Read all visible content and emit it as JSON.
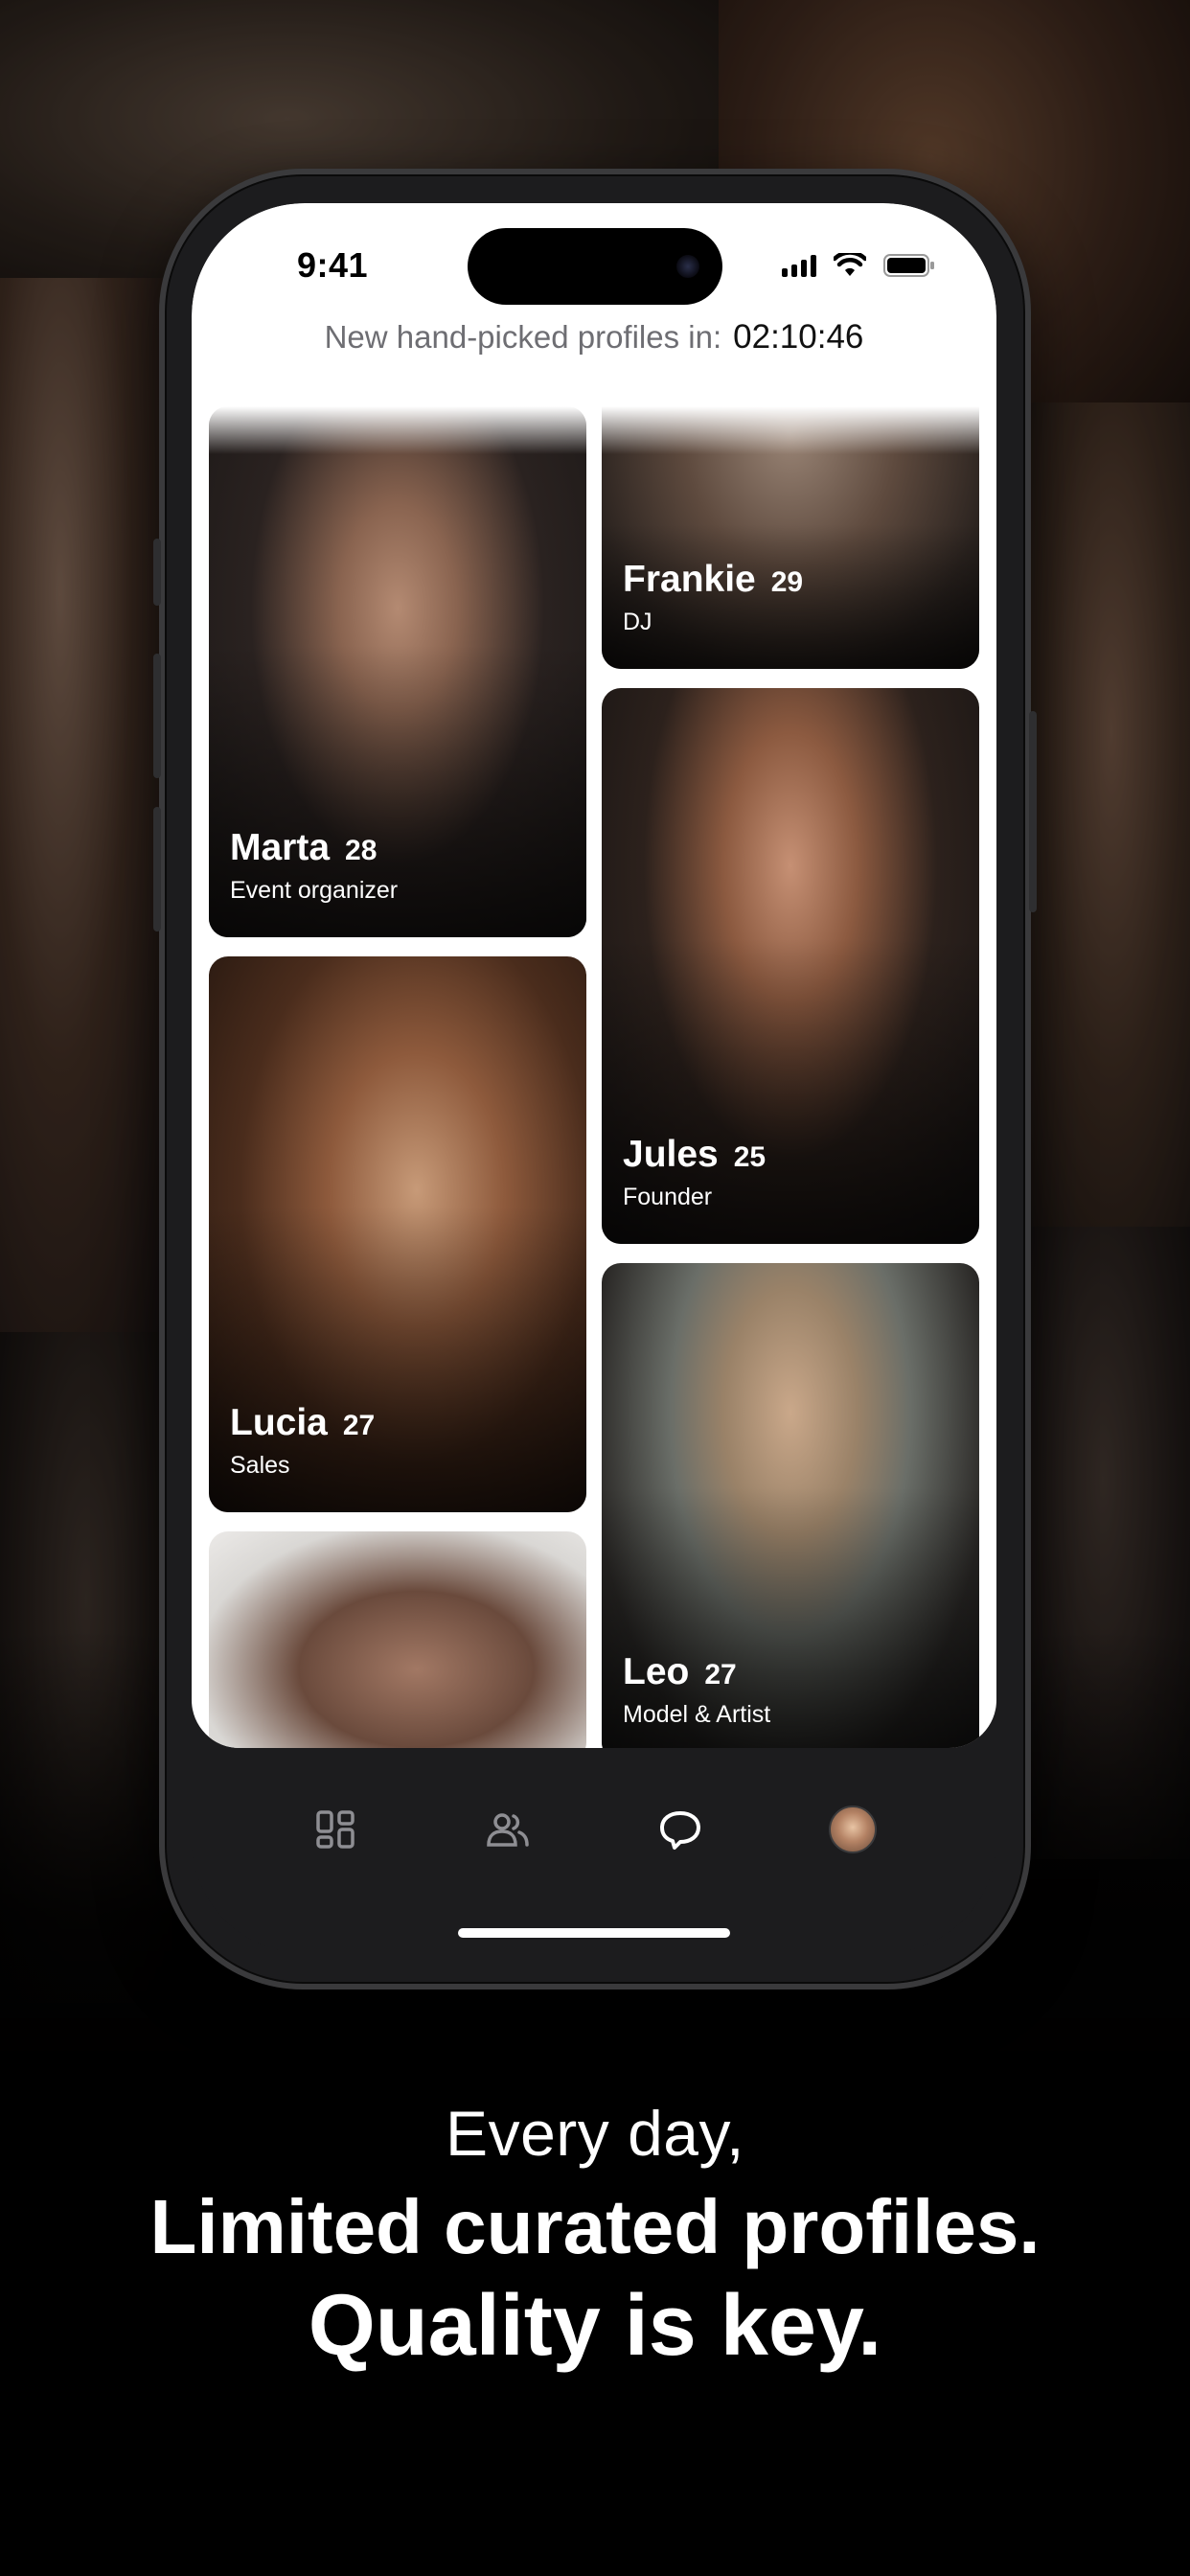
{
  "status_bar": {
    "time": "9:41"
  },
  "header": {
    "label": "New hand-picked profiles in:",
    "timer": "02:10:46"
  },
  "profiles": {
    "marta": {
      "name": "Marta",
      "age": "28",
      "job": "Event organizer"
    },
    "lucia": {
      "name": "Lucia",
      "age": "27",
      "job": "Sales"
    },
    "frankie": {
      "name": "Frankie",
      "age": "29",
      "job": "DJ"
    },
    "jules": {
      "name": "Jules",
      "age": "25",
      "job": "Founder"
    },
    "leo": {
      "name": "Leo",
      "age": "27",
      "job": "Model & Artist"
    }
  },
  "tab_bar": {
    "tabs": [
      {
        "icon": "grid-icon"
      },
      {
        "icon": "people-icon"
      },
      {
        "icon": "chat-bubble-icon"
      },
      {
        "icon": "profile-avatar"
      }
    ]
  },
  "captions": {
    "line1": "Every day,",
    "line2": "Limited curated profiles.",
    "line3": "Quality is key."
  },
  "colors": {
    "screen_bg": "#ffffff",
    "tab_bar_bg": "#1c1c1e",
    "caption_text": "#ffffff",
    "muted_text": "#6e6e73"
  }
}
